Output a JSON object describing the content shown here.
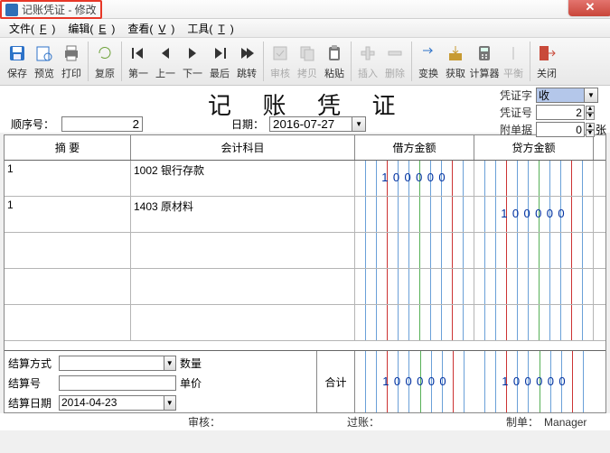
{
  "window": {
    "title": "记账凭证 - 修改"
  },
  "menubar": [
    {
      "label": "文件",
      "accel": "F"
    },
    {
      "label": "编辑",
      "accel": "E"
    },
    {
      "label": "查看",
      "accel": "V"
    },
    {
      "label": "工具",
      "accel": "T"
    }
  ],
  "toolbar": {
    "groups": [
      [
        {
          "id": "save",
          "label": "保存",
          "icon": "save",
          "color": "#2d72c8"
        },
        {
          "id": "preview",
          "label": "预览",
          "icon": "preview",
          "color": "#2d72c8"
        },
        {
          "id": "print",
          "label": "打印",
          "icon": "print",
          "color": "#777"
        }
      ],
      [
        {
          "id": "restore",
          "label": "复原",
          "icon": "restore",
          "color": "#6ea23a"
        }
      ],
      [
        {
          "id": "first",
          "label": "第一",
          "icon": "first",
          "color": "#333"
        },
        {
          "id": "prev",
          "label": "上一",
          "icon": "prev",
          "color": "#333"
        },
        {
          "id": "next",
          "label": "下一",
          "icon": "next",
          "color": "#333"
        },
        {
          "id": "last",
          "label": "最后",
          "icon": "last",
          "color": "#333"
        },
        {
          "id": "goto",
          "label": "跳转",
          "icon": "goto",
          "color": "#333"
        }
      ],
      [
        {
          "id": "audit",
          "label": "审核",
          "icon": "audit",
          "color": "#bbb",
          "disabled": true
        },
        {
          "id": "copyto",
          "label": "拷贝",
          "icon": "copy",
          "color": "#bbb",
          "disabled": true
        },
        {
          "id": "paste",
          "label": "粘贴",
          "icon": "paste",
          "color": "#777"
        }
      ],
      [
        {
          "id": "insrow",
          "label": "插入",
          "icon": "ins",
          "color": "#bbb",
          "disabled": true
        },
        {
          "id": "delrow",
          "label": "删除",
          "icon": "del",
          "color": "#bbb",
          "disabled": true
        }
      ],
      [
        {
          "id": "swap",
          "label": "变换",
          "icon": "swap",
          "color": "#2d72c8"
        },
        {
          "id": "fetch",
          "label": "获取",
          "icon": "fetch",
          "color": "#c79a32"
        },
        {
          "id": "calc",
          "label": "计算器",
          "icon": "calc",
          "color": "#777"
        },
        {
          "id": "balance",
          "label": "平衡",
          "icon": "bal",
          "color": "#bbb",
          "disabled": true
        }
      ],
      [
        {
          "id": "close",
          "label": "关闭",
          "icon": "exit",
          "color": "#c94a3a"
        }
      ]
    ]
  },
  "header": {
    "title": "记 账 凭 证",
    "vouchWordLabel": "凭证字",
    "vouchWord": "收",
    "vouchNoLabel": "凭证号",
    "vouchNo": "2",
    "attachLabel": "附单据",
    "attach": "0",
    "attachUnit": "张",
    "seqLabel": "顺序号：",
    "seq": "2",
    "dateLabel": "日期：",
    "date": "2016-07-27"
  },
  "grid": {
    "headers": {
      "summary": "摘 要",
      "account": "会计科目",
      "debit": "借方金额",
      "credit": "贷方金额"
    },
    "rows": [
      {
        "summary": "1",
        "account": "1002 银行存款",
        "debit": "100000",
        "credit": ""
      },
      {
        "summary": "1",
        "account": "1403 原材料",
        "debit": "",
        "credit": "100000"
      },
      {
        "summary": "",
        "account": "",
        "debit": "",
        "credit": ""
      },
      {
        "summary": "",
        "account": "",
        "debit": "",
        "credit": ""
      },
      {
        "summary": "",
        "account": "",
        "debit": "",
        "credit": ""
      }
    ],
    "footer": {
      "settleTypeLabel": "结算方式",
      "settleType": "",
      "settleNoLabel": "结算号",
      "settleNo": "",
      "settleDateLabel": "结算日期",
      "settleDate": "2014-04-23",
      "qtyLabel": "数量",
      "qty": "",
      "priceLabel": "单价",
      "price": "",
      "totalLabel": "合计",
      "debitTotal": "100000",
      "creditTotal": "100000"
    }
  },
  "status": {
    "auditLabel": "审核：",
    "audit": "",
    "postLabel": "过账：",
    "post": "",
    "makerLabel": "制单：",
    "maker": "Manager"
  }
}
